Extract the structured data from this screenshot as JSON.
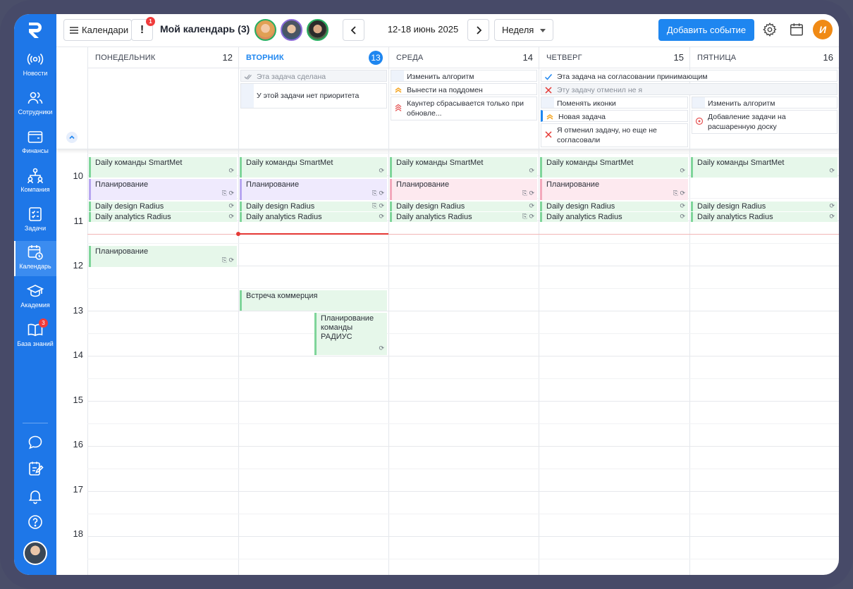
{
  "sidebar": {
    "items": [
      {
        "label": "Новости",
        "icon": "broadcast-icon"
      },
      {
        "label": "Сотрудники",
        "icon": "users-icon"
      },
      {
        "label": "Финансы",
        "icon": "wallet-icon"
      },
      {
        "label": "Компания",
        "icon": "org-icon"
      },
      {
        "label": "Задачи",
        "icon": "tasks-icon"
      },
      {
        "label": "Календарь",
        "icon": "calendar-clock-icon"
      },
      {
        "label": "Академия",
        "icon": "graduation-cap-icon"
      },
      {
        "label": "База знаний",
        "icon": "book-icon"
      }
    ],
    "knowledge_badge": "3"
  },
  "topbar": {
    "calendars_label": "Календари",
    "alert_badge": "1",
    "title": "Мой календарь (3)",
    "date_range": "12-18 июнь 2025",
    "view_select": "Неделя",
    "add_event": "Добавить событие",
    "user_initial": "И"
  },
  "days": [
    {
      "name": "Понедельник",
      "date": "12"
    },
    {
      "name": "Вторник",
      "date": "13"
    },
    {
      "name": "Среда",
      "date": "14"
    },
    {
      "name": "Четверг",
      "date": "15"
    },
    {
      "name": "Пятница",
      "date": "16"
    }
  ],
  "tasks": {
    "tue": [
      "Эта задача сделана",
      "У этой задачи нет приоритета"
    ],
    "wed": [
      "Изменить алгоритм",
      "Вынести на поддомен",
      "Каунтер сбрасывается только при обновле..."
    ],
    "thu": [
      "Эта задача на согласовании принимающим",
      "Эту задачу отменил не я",
      "Поменять иконки",
      "Новая задача",
      "Я отменил задачу, но еще не согласовали"
    ],
    "fri": [
      "Изменить алгоритм",
      "Добавление задачи на расшаренную доску"
    ]
  },
  "hours": [
    "10",
    "11",
    "12",
    "13",
    "14",
    "15",
    "16",
    "17",
    "18"
  ],
  "events": {
    "daily": "Daily команды SmartMet",
    "planning": "Планирование",
    "design": "Daily design Radius",
    "analytics": "Daily analytics Radius",
    "meeting": "Встреча коммерция",
    "radius_planning": "Планирование команды РАДИУС"
  }
}
